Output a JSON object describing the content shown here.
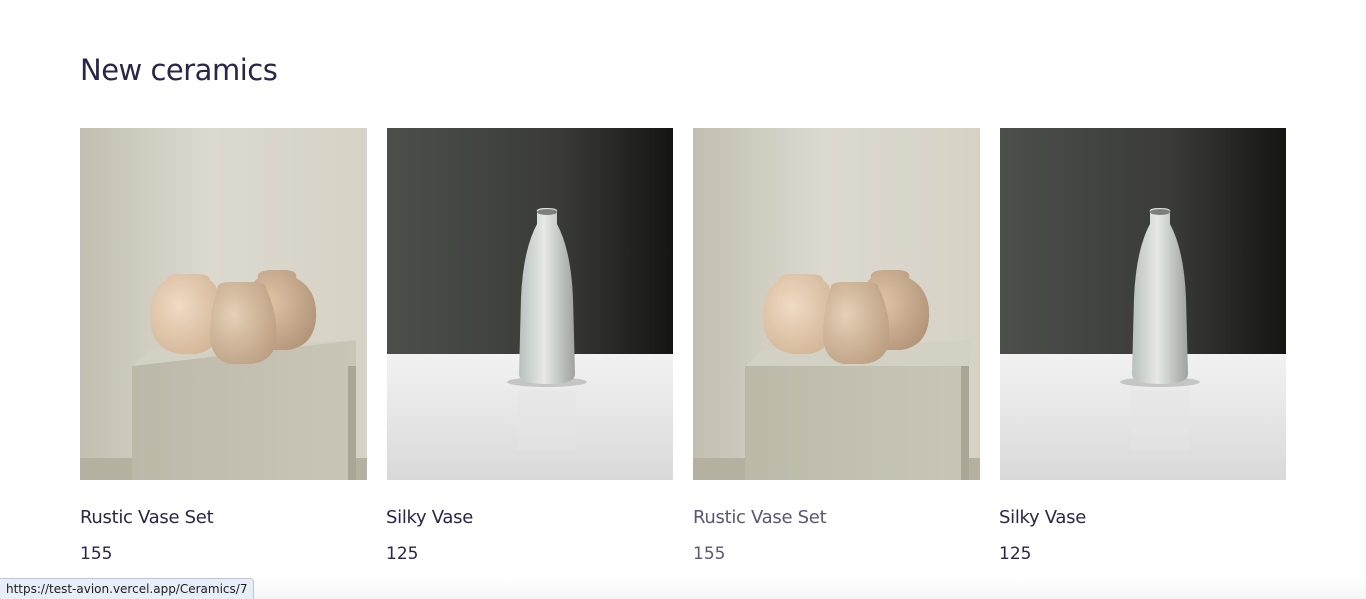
{
  "section": {
    "title": "New ceramics"
  },
  "products": [
    {
      "name": "Rustic Vase Set",
      "price": "155",
      "image": "rustic-vase-set-photo"
    },
    {
      "name": "Silky Vase",
      "price": "125",
      "image": "silky-vase-photo"
    },
    {
      "name": "Rustic Vase Set",
      "price": "155",
      "image": "rustic-vase-set-photo"
    },
    {
      "name": "Silky Vase",
      "price": "125",
      "image": "silky-vase-photo"
    }
  ],
  "status_bar": {
    "url": "https://test-avion.vercel.app/Ceramics/7"
  },
  "colors": {
    "heading": "#2a254b",
    "hover_text": "#5b5676"
  }
}
